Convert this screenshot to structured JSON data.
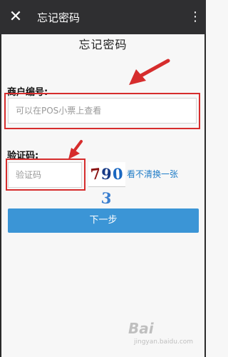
{
  "topbar": {
    "close_icon": "✕",
    "title": "忘记密码",
    "more_icon": "⋮"
  },
  "page": {
    "title": "忘记密码"
  },
  "form": {
    "merchant_label": "商户编号:",
    "merchant_placeholder": "可以在POS小票上查看",
    "captcha_label": "验证码:",
    "captcha_placeholder": "验证码",
    "captcha_image": {
      "digits": [
        "7",
        "9",
        "0",
        "3"
      ]
    },
    "refresh_link": "看不清换一张",
    "next_button": "下一步"
  },
  "annotations": {
    "highlight_color": "#d62d2d"
  },
  "watermark": {
    "brand": "Bai",
    "site": "jingyan.baidu.com"
  }
}
